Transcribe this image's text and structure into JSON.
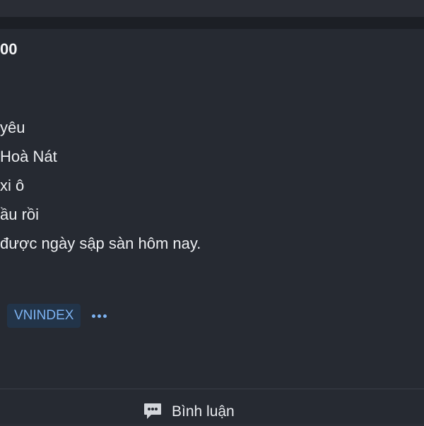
{
  "post": {
    "title": "00",
    "lines": [
      "yêu",
      "Hoà Nát",
      "xi ô",
      "ầu rồi",
      "được ngày sập sàn hôm nay."
    ]
  },
  "tags": {
    "items": [
      "VNINDEX"
    ],
    "more_icon": "ellipsis-icon"
  },
  "actions": {
    "comment_label": "Bình luận",
    "comment_icon": "comment-bubble-icon"
  },
  "colors": {
    "background": "#262a32",
    "tag_background": "#223449",
    "tag_text": "#7db3f2"
  }
}
